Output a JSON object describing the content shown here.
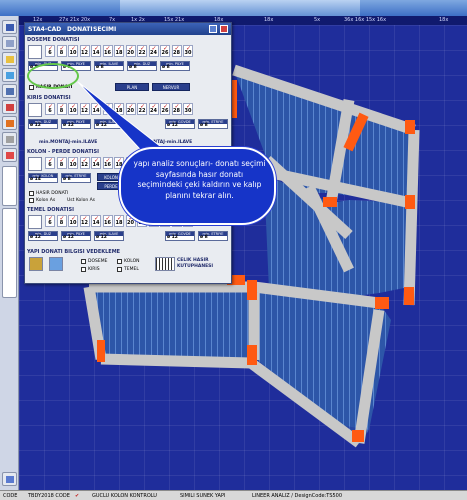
{
  "ruler": {
    "ticks": [
      "12x",
      "27x 21x 20x",
      "7x",
      "1x 2x",
      "15x 21x",
      "18x",
      "18x",
      "5x",
      "36x 16x 15x 16x",
      "18x"
    ]
  },
  "status": {
    "code": "CODE",
    "tbdy": "TBDY2018 CODE",
    "guclu": "GUCLU KOLON KONTROLU",
    "simili": "SIMILI SUNEK YAPI",
    "lineer": "LINEER ANALIZ / DesignCode:TS500"
  },
  "dialog": {
    "title": "STA4-CAD",
    "tab2": "DONATI",
    "tab3": "SECIMI",
    "doseme": {
      "heading": "DOSEME DONATISI",
      "bars": [
        "6",
        "8",
        "10",
        "12",
        "14",
        "16",
        "18",
        "20",
        "22",
        "24",
        "26",
        "28",
        "30"
      ],
      "inputs": [
        {
          "label": "min. DUZ",
          "value": "ø 8"
        },
        {
          "label": "min. PILYE",
          "value": "ø 8"
        },
        {
          "label": "min. ILAVE",
          "value": "ø 8"
        },
        {
          "label": "min. DUZ",
          "value": "ø 8"
        },
        {
          "label": "min. PILYE",
          "value": "ø 8"
        }
      ],
      "hasir_label": "HASIR DONATI",
      "plan_btn": "PLAN",
      "nervur_btn": "NERVUR"
    },
    "kiris": {
      "heading": "KIRIS DONATISI",
      "bars": [
        "6",
        "8",
        "10",
        "12",
        "14",
        "16",
        "18",
        "20",
        "22",
        "24",
        "26",
        "28",
        "30"
      ],
      "inputs": [
        {
          "label": "min. DUZ",
          "value": "ø 12"
        },
        {
          "label": "min. PILYE",
          "value": "ø 12"
        },
        {
          "label": "min. ILAVE",
          "value": "ø 12"
        },
        {
          "label": "min. GOVDE",
          "value": "ø 12"
        },
        {
          "label": "min. ETRIYE",
          "value": "ø 8"
        }
      ],
      "note": "min.MONTAJ-min.ILAVE",
      "note2": "MONTAJ-min.ILAVE"
    },
    "kolon": {
      "heading": "KOLON - PERDE DONATISI",
      "bars": [
        "6",
        "8",
        "10",
        "12",
        "14",
        "16",
        "18",
        "20",
        "22",
        "24",
        "26",
        "28",
        "30"
      ],
      "inputs": [
        {
          "label": "min. KOLON",
          "value": "ø 14"
        },
        {
          "label": "min. ETRIYE",
          "value": "ø 8"
        }
      ],
      "kolon_btn": "KOLON",
      "perde_btn": "PERDE",
      "hasir_label": "HASIR DONATI",
      "kolon_as": "Kolon As",
      "ust_kolon": "Ust Kolon As"
    },
    "temel": {
      "heading": "TEMEL DONATISI",
      "bars": [
        "6",
        "8",
        "10",
        "12",
        "14",
        "16",
        "18",
        "20",
        "22",
        "24",
        "26",
        "28",
        "30"
      ],
      "inputs": [
        {
          "label": "min. DUZ",
          "value": "ø 12"
        },
        {
          "label": "min. PILYE",
          "value": "ø 12"
        },
        {
          "label": "min. ILAVE",
          "value": "ø 12"
        },
        {
          "label": "min. GOVDE",
          "value": "ø 12"
        },
        {
          "label": "min. ETRIYE",
          "value": "ø 8"
        }
      ]
    },
    "footer": {
      "heading": "YAPI DONATI BILGISI VEDEKLEME",
      "doseme": "DOSEME",
      "kiris": "KIRIS",
      "kolon": "KOLON",
      "temel": "TEMEL",
      "celik_l1": "CELIK HASIR",
      "celik_l2": "KUTUPHANESI"
    }
  },
  "callout": {
    "text": "yapı analiz sonuçları- donatı seçimi sayfasında hasır donatı seçimindeki çeki kaldırın ve kalıp planını tekrar alın."
  },
  "colors": {
    "canvas": "#1f2d9b",
    "beam": "#c0c0c0",
    "column": "#ff5a12",
    "slab": "#2a4fa0",
    "callout": "#1634c8"
  }
}
